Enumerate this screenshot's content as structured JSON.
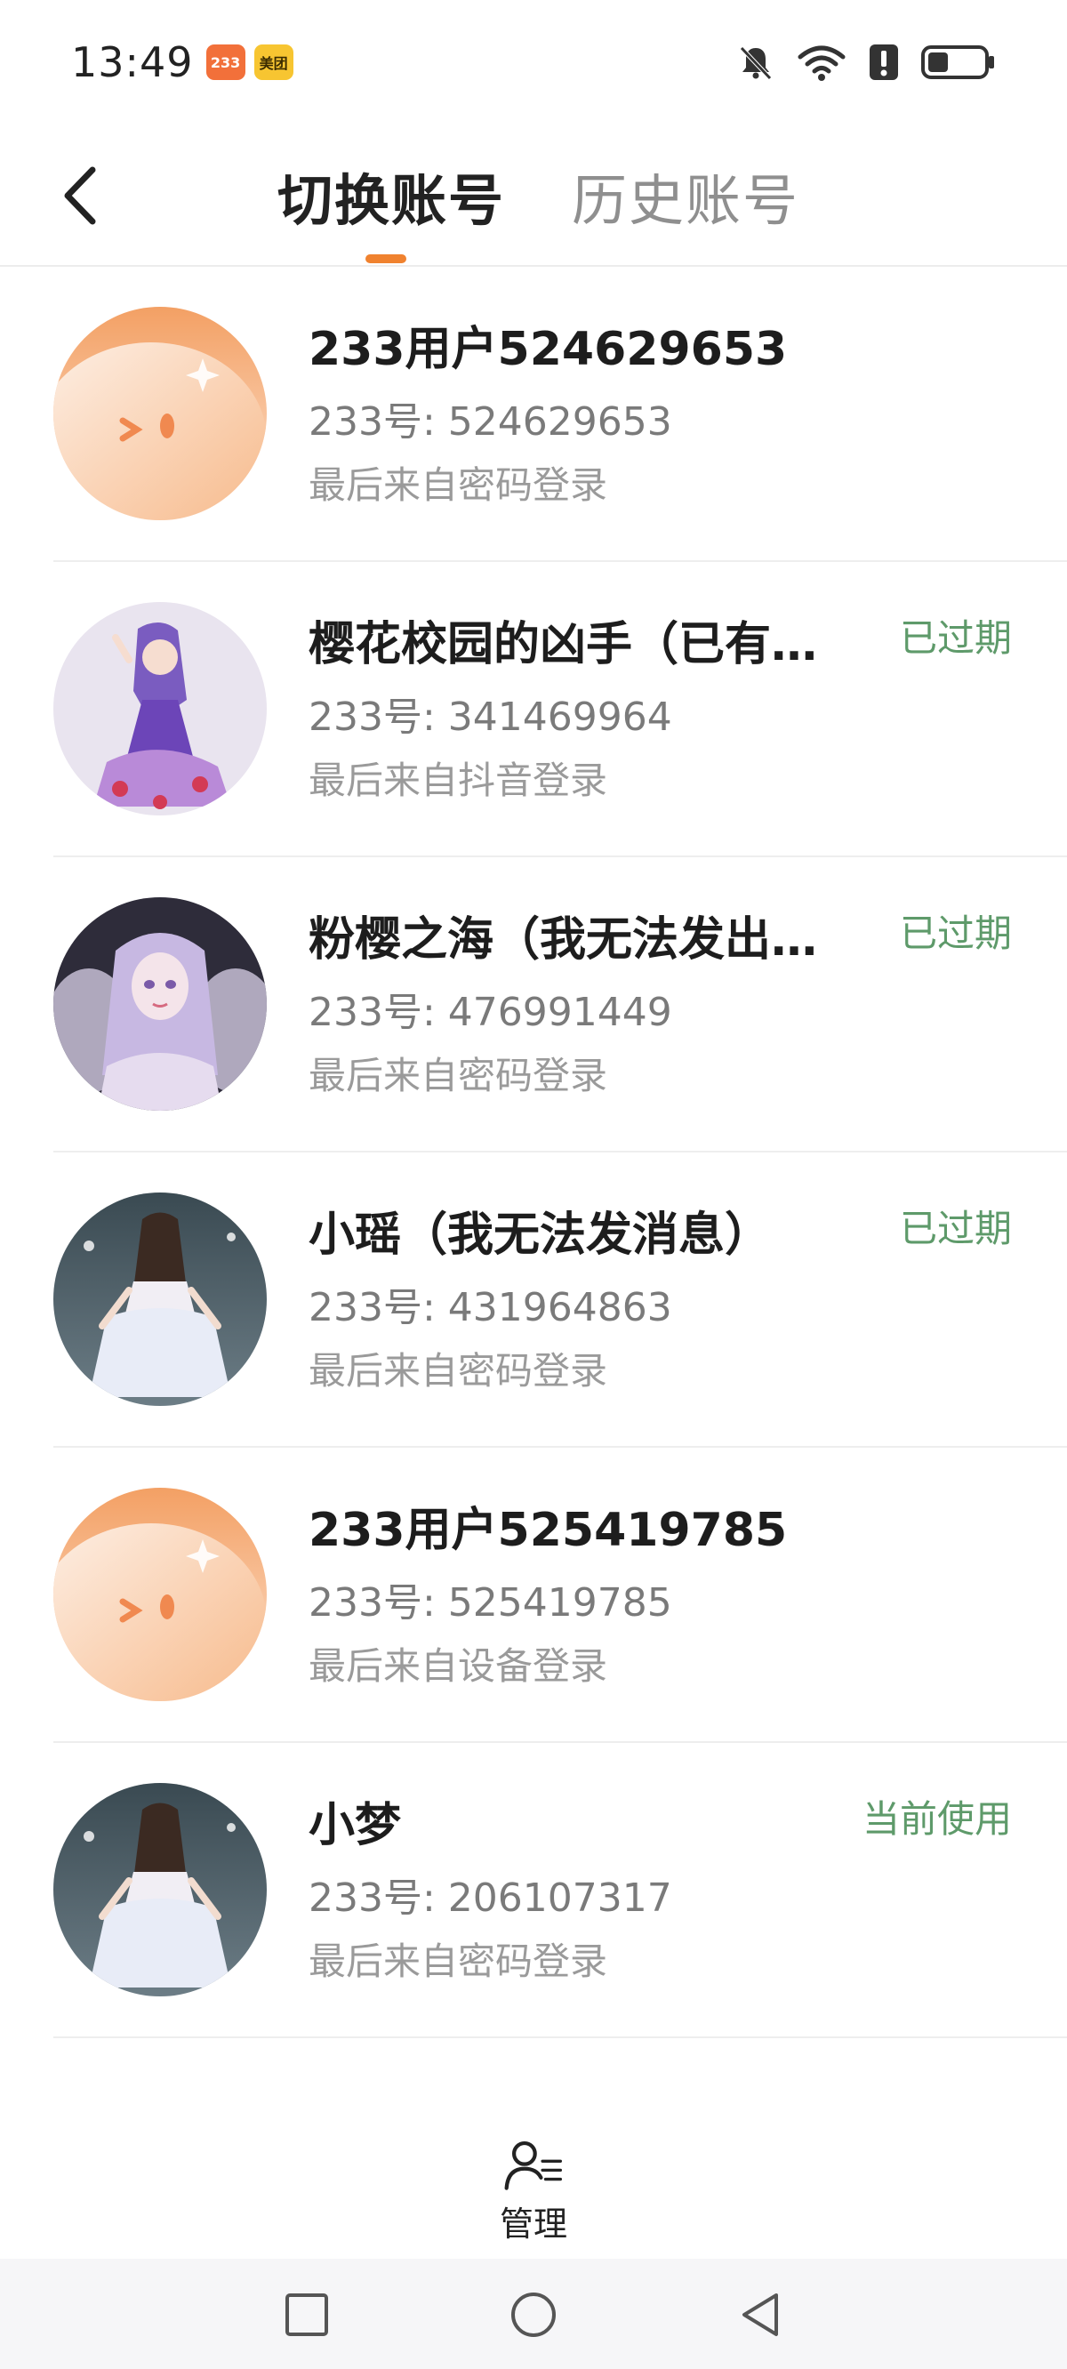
{
  "status_bar": {
    "time": "13:49",
    "badge_233": "233",
    "badge_meituan": "美团",
    "icons": [
      "bell-muted-icon",
      "wifi-icon",
      "alert-icon",
      "battery-icon"
    ]
  },
  "header": {
    "tab_switch": "切换账号",
    "tab_history": "历史账号",
    "accent_color": "#f0822f"
  },
  "accounts": [
    {
      "name": "233用户524629653",
      "id_text": "233号: 524629653",
      "source": "最后来自密码登录",
      "status": ""
    },
    {
      "name": "樱花校园的凶手（已有…",
      "id_text": "233号: 341469964",
      "source": "最后来自抖音登录",
      "status": "已过期"
    },
    {
      "name": "粉樱之海（我无法发出…",
      "id_text": "233号: 476991449",
      "source": "最后来自密码登录",
      "status": "已过期"
    },
    {
      "name": "小瑶（我无法发消息）",
      "id_text": "233号: 431964863",
      "source": "最后来自密码登录",
      "status": "已过期"
    },
    {
      "name": "233用户525419785",
      "id_text": "233号: 525419785",
      "source": "最后来自设备登录",
      "status": ""
    },
    {
      "name": "小梦",
      "id_text": "233号: 206107317",
      "source": "最后来自密码登录",
      "status": "当前使用"
    }
  ],
  "manage": {
    "label": "管理"
  },
  "colors": {
    "status_green": "#5e9a6a",
    "avatar_orange": "#f6a56a"
  }
}
